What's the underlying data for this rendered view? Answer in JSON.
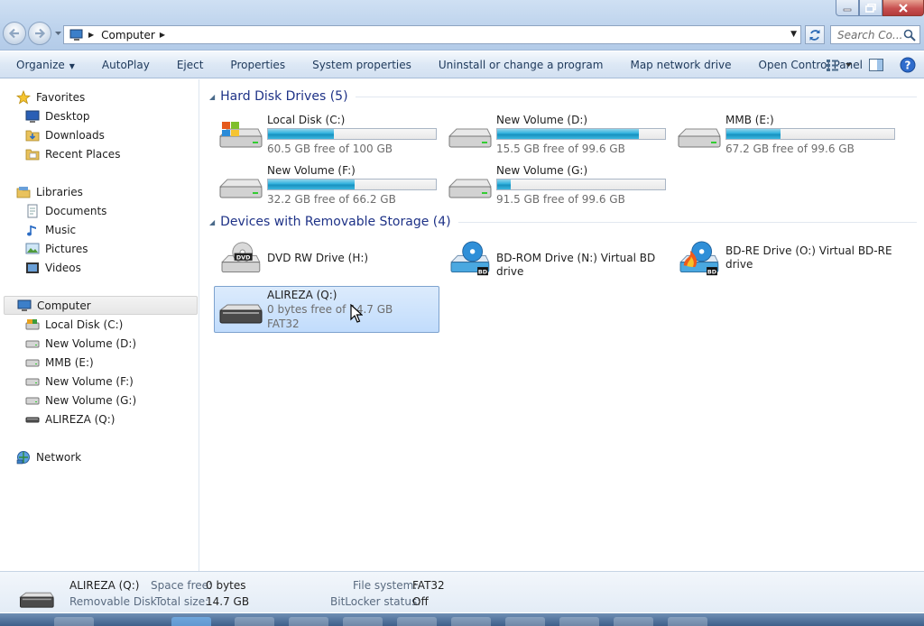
{
  "window": {
    "title": "Computer",
    "minimize": "minimize",
    "maximize": "maximize",
    "close": "close"
  },
  "address": {
    "crumbs": [
      "Computer"
    ],
    "search_placeholder": "Search Co..."
  },
  "toolbar": {
    "organize": "Organize",
    "autoplay": "AutoPlay",
    "eject": "Eject",
    "properties": "Properties",
    "system_properties": "System properties",
    "uninstall": "Uninstall or change a program",
    "map_network": "Map network drive",
    "control_panel": "Open Control Panel"
  },
  "nav": {
    "favorites": "Favorites",
    "desktop": "Desktop",
    "downloads": "Downloads",
    "recent": "Recent Places",
    "libraries": "Libraries",
    "documents": "Documents",
    "music": "Music",
    "pictures": "Pictures",
    "videos": "Videos",
    "computer": "Computer",
    "drive_c": "Local Disk (C:)",
    "drive_d": "New Volume (D:)",
    "drive_e": "MMB (E:)",
    "drive_f": "New Volume (F:)",
    "drive_g": "New Volume (G:)",
    "drive_q": "ALIREZA (Q:)",
    "network": "Network"
  },
  "groups": {
    "hdd": "Hard Disk Drives (5)",
    "removable": "Devices with Removable Storage (4)"
  },
  "drives": [
    {
      "name": "Local Disk (C:)",
      "free": "60.5 GB free of 100 GB",
      "used_fraction": 0.395,
      "accent": "#2eb0dd"
    },
    {
      "name": "New Volume (D:)",
      "free": "15.5 GB free of 99.6 GB",
      "used_fraction": 0.844,
      "accent": "#2eb0dd"
    },
    {
      "name": "MMB (E:)",
      "free": "67.2 GB free of 99.6 GB",
      "used_fraction": 0.325,
      "accent": "#2eb0dd"
    },
    {
      "name": "New Volume (F:)",
      "free": "32.2 GB free of 66.2 GB",
      "used_fraction": 0.514,
      "accent": "#2eb0dd"
    },
    {
      "name": "New Volume (G:)",
      "free": "91.5 GB free of 99.6 GB",
      "used_fraction": 0.081,
      "accent": "#2eb0dd"
    }
  ],
  "removable": [
    {
      "name": "DVD RW Drive (H:)",
      "icon": "dvd-drive-icon"
    },
    {
      "name": "BD-ROM Drive (N:) Virtual BD drive",
      "icon": "bd-rom-icon"
    },
    {
      "name": "BD-RE Drive (O:) Virtual BD-RE drive",
      "icon": "bd-re-icon"
    },
    {
      "name": "ALIREZA (Q:)",
      "free": "0 bytes free of 14.7 GB",
      "fs": "FAT32",
      "icon": "removable-disk-icon"
    }
  ],
  "details": {
    "name": "ALIREZA (Q:)",
    "type": "Removable Disk",
    "space_free_label": "Space free:",
    "space_free": "0 bytes",
    "total_size_label": "Total size:",
    "total_size": "14.7 GB",
    "fs_label": "File system:",
    "fs": "FAT32",
    "bitlocker_label": "BitLocker status:",
    "bitlocker": "Off"
  }
}
